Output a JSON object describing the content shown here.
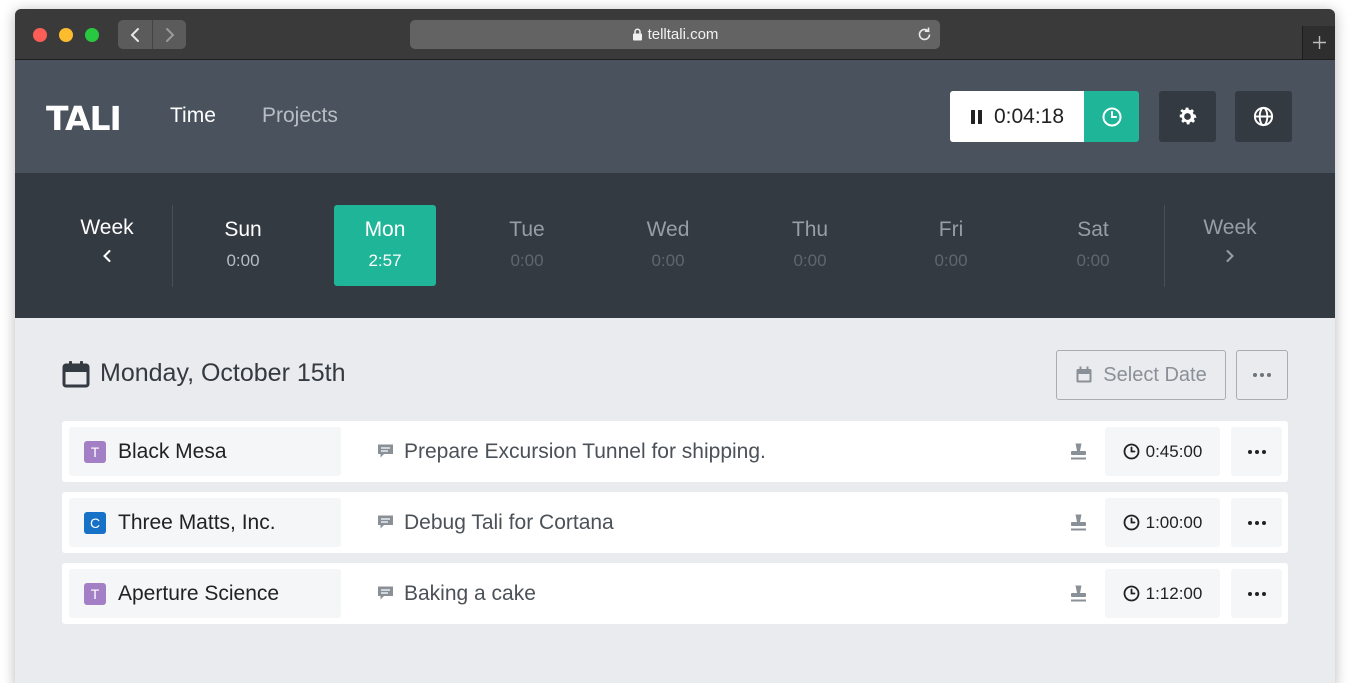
{
  "browser": {
    "url": "telltali.com"
  },
  "header": {
    "logo": "TALI",
    "nav": [
      {
        "label": "Time",
        "active": true
      },
      {
        "label": "Projects",
        "active": false
      }
    ],
    "timer": {
      "elapsed": "0:04:18",
      "state": "running"
    },
    "accent_color": "#1fb598"
  },
  "week": {
    "prev_label": "Week",
    "next_label": "Week",
    "days": [
      {
        "name": "Sun",
        "total": "0:00",
        "state": "past"
      },
      {
        "name": "Mon",
        "total": "2:57",
        "state": "active"
      },
      {
        "name": "Tue",
        "total": "0:00",
        "state": "future"
      },
      {
        "name": "Wed",
        "total": "0:00",
        "state": "future"
      },
      {
        "name": "Thu",
        "total": "0:00",
        "state": "future"
      },
      {
        "name": "Fri",
        "total": "0:00",
        "state": "future"
      },
      {
        "name": "Sat",
        "total": "0:00",
        "state": "future"
      }
    ]
  },
  "main": {
    "date_heading": "Monday, October 15th",
    "select_date_label": "Select Date",
    "entries": [
      {
        "badge": "T",
        "badge_color": "#a37fc5",
        "project": "Black Mesa",
        "description": "Prepare Excursion Tunnel for shipping.",
        "duration": "0:45:00"
      },
      {
        "badge": "C",
        "badge_color": "#1771c6",
        "project": "Three Matts, Inc.",
        "description": "Debug Tali for Cortana",
        "duration": "1:00:00"
      },
      {
        "badge": "T",
        "badge_color": "#a37fc5",
        "project": "Aperture Science",
        "description": "Baking a cake",
        "duration": "1:12:00"
      }
    ]
  }
}
